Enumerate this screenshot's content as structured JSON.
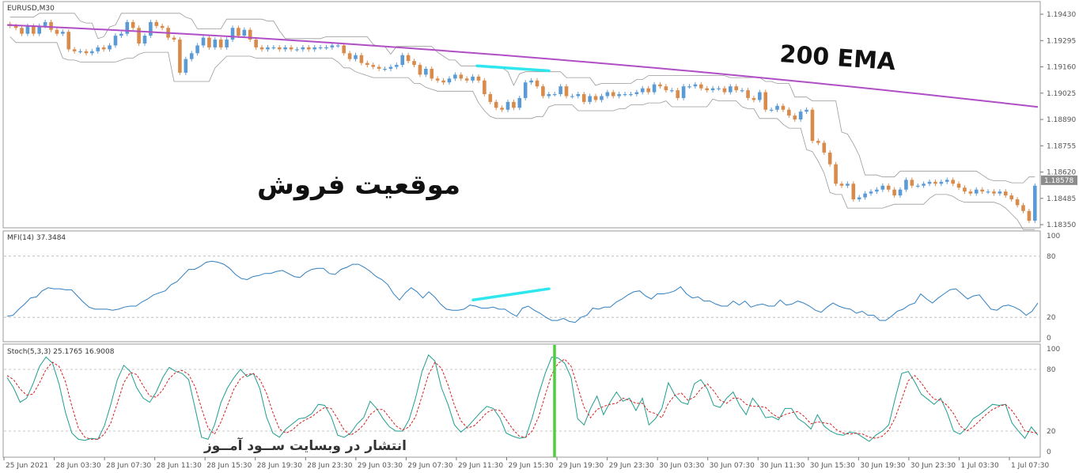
{
  "chart_header": {
    "symbol": "EURUSD,M30",
    "mfi_label": "MFI(14) 37.3484",
    "stoch_label": "Stoch(5,3,3) 25.1765 16.9008"
  },
  "annotations": {
    "position_text": "موقعیت فروش",
    "ema_text": "200 EMA",
    "footer_text": "انتشار در وبسایت ســود آمــوز"
  },
  "colors": {
    "bull": "#5b9bd5",
    "bear": "#d98b4b",
    "ema": "#b04fc5",
    "band": "#9a9a9a",
    "mfi": "#2f7fc1",
    "stoch_main": "#1f9e8f",
    "stoch_signal": "#d42020",
    "divergence": "#2ee6ee",
    "vline": "#4ccf3c"
  },
  "chart_data": [
    {
      "type": "candlestick",
      "title": "EURUSD,M30",
      "price_ticks": [
        "1.19430",
        "1.19295",
        "1.19160",
        "1.19025",
        "1.18890",
        "1.18755",
        "1.18620",
        "1.18485",
        "1.18350"
      ],
      "current_price": "1.18578",
      "ylim": [
        1.18342,
        1.19487
      ],
      "x_ticks": [
        "25 Jun 2021",
        "28 Jun 03:30",
        "28 Jun 07:30",
        "28 Jun 11:30",
        "28 Jun 15:30",
        "28 Jun 19:30",
        "28 Jun 23:30",
        "29 Jun 03:30",
        "29 Jun 07:30",
        "29 Jun 11:30",
        "29 Jun 15:30",
        "29 Jun 19:30",
        "29 Jun 23:30",
        "30 Jun 03:30",
        "30 Jun 07:30",
        "30 Jun 11:30",
        "30 Jun 15:30",
        "30 Jun 19:30",
        "30 Jun 23:30",
        "1 Jul 03:30",
        "1 Jul 07:30"
      ],
      "close": [
        1.1937,
        1.1936,
        1.1933,
        1.1937,
        1.1933,
        1.1937,
        1.1939,
        1.1935,
        1.1933,
        1.1934,
        1.1925,
        1.1924,
        1.1924,
        1.1923,
        1.1924,
        1.1926,
        1.1925,
        1.1927,
        1.1932,
        1.1933,
        1.1939,
        1.1936,
        1.1928,
        1.1932,
        1.1939,
        1.1937,
        1.1936,
        1.1931,
        1.193,
        1.1913,
        1.192,
        1.1923,
        1.1927,
        1.1931,
        1.1926,
        1.193,
        1.1926,
        1.193,
        1.1936,
        1.1932,
        1.1935,
        1.193,
        1.1926,
        1.1925,
        1.1926,
        1.1926,
        1.1925,
        1.1926,
        1.1925,
        1.1925,
        1.1926,
        1.1925,
        1.1926,
        1.1926,
        1.1926,
        1.1927,
        1.1927,
        1.1923,
        1.192,
        1.1922,
        1.1918,
        1.1917,
        1.1916,
        1.1915,
        1.1915,
        1.1916,
        1.1917,
        1.1922,
        1.1919,
        1.1917,
        1.1912,
        1.1915,
        1.191,
        1.1909,
        1.1908,
        1.191,
        1.1912,
        1.191,
        1.1909,
        1.1911,
        1.1909,
        1.1902,
        1.1898,
        1.1895,
        1.1894,
        1.1898,
        1.1895,
        1.19,
        1.1908,
        1.1909,
        1.1906,
        1.1901,
        1.1902,
        1.1902,
        1.1906,
        1.1901,
        1.1901,
        1.1902,
        1.1898,
        1.1901,
        1.1899,
        1.1901,
        1.1903,
        1.1901,
        1.1902,
        1.1902,
        1.1902,
        1.1903,
        1.1905,
        1.1903,
        1.1907,
        1.1906,
        1.1904,
        1.1904,
        1.19,
        1.1906,
        1.1906,
        1.1907,
        1.1905,
        1.1904,
        1.1905,
        1.1905,
        1.1903,
        1.1906,
        1.1904,
        1.1904,
        1.19,
        1.1899,
        1.1903,
        1.1894,
        1.1894,
        1.1896,
        1.1894,
        1.1891,
        1.1889,
        1.1893,
        1.1894,
        1.1878,
        1.1877,
        1.1872,
        1.1866,
        1.1856,
        1.1855,
        1.1856,
        1.1848,
        1.1849,
        1.1851,
        1.1852,
        1.1853,
        1.1855,
        1.1853,
        1.185,
        1.1853,
        1.1858,
        1.1855,
        1.1855,
        1.1856,
        1.1857,
        1.1856,
        1.1857,
        1.1858,
        1.1856,
        1.1854,
        1.1852,
        1.1851,
        1.1853,
        1.1852,
        1.1852,
        1.1851,
        1.1852,
        1.185,
        1.1848,
        1.1845,
        1.1842,
        1.1837,
        1.1855
      ],
      "ema200_endpoints": [
        1.19375,
        1.18954
      ],
      "bands": "upper/lower price envelope",
      "divergence_line": [
        "1.19165",
        "1.19140"
      ]
    },
    {
      "type": "line",
      "title": "MFI(14) 37.3484",
      "ylim": [
        0,
        100
      ],
      "y_ticks": [
        "100",
        "80",
        "20",
        "0"
      ],
      "levels": [
        80,
        20
      ],
      "values": [
        21,
        22,
        28,
        33,
        39,
        40,
        46,
        49,
        48,
        48,
        47,
        47,
        41,
        35,
        30,
        28,
        28,
        28,
        27,
        28,
        30,
        31,
        31,
        35,
        38,
        42,
        44,
        46,
        52,
        55,
        61,
        67,
        67,
        70,
        74,
        75,
        74,
        72,
        68,
        62,
        58,
        57,
        60,
        61,
        63,
        63,
        65,
        66,
        63,
        60,
        59,
        64,
        67,
        68,
        68,
        63,
        62,
        67,
        69,
        72,
        72,
        69,
        65,
        60,
        57,
        52,
        43,
        37,
        44,
        49,
        45,
        39,
        45,
        40,
        33,
        28,
        27,
        27,
        28,
        32,
        31,
        29,
        29,
        30,
        28,
        28,
        24,
        21,
        29,
        31,
        27,
        24,
        20,
        17,
        17,
        19,
        16,
        15,
        20,
        22,
        29,
        28,
        30,
        30,
        35,
        38,
        42,
        45,
        46,
        41,
        38,
        43,
        43,
        44,
        46,
        50,
        43,
        39,
        40,
        36,
        36,
        33,
        31,
        31,
        36,
        32,
        36,
        30,
        32,
        33,
        31,
        31,
        37,
        32,
        33,
        36,
        34,
        31,
        27,
        25,
        30,
        34,
        31,
        29,
        28,
        24,
        26,
        22,
        22,
        17,
        17,
        21,
        26,
        28,
        32,
        34,
        43,
        38,
        34,
        39,
        43,
        47,
        48,
        43,
        38,
        41,
        42,
        35,
        28,
        27,
        31,
        32,
        30,
        27,
        22,
        26,
        34
      ],
      "divergence_line": "rising"
    },
    {
      "type": "line",
      "title": "Stoch(5,3,3) 25.1765 16.9008",
      "ylim": [
        0,
        100
      ],
      "y_ticks": [
        "100",
        "80",
        "20",
        "0"
      ],
      "levels": [
        80,
        20
      ],
      "series": [
        {
          "name": "Stoch(5,3,3) 25.1765",
          "values": [
            72,
            62,
            48,
            52,
            66,
            83,
            92,
            86,
            66,
            38,
            18,
            12,
            11,
            13,
            12,
            25,
            46,
            70,
            84,
            78,
            62,
            52,
            48,
            58,
            72,
            82,
            78,
            76,
            70,
            42,
            14,
            12,
            26,
            48,
            62,
            72,
            80,
            73,
            76,
            61,
            34,
            18,
            14,
            22,
            27,
            32,
            33,
            37,
            46,
            45,
            34,
            16,
            14,
            18,
            27,
            33,
            49,
            42,
            32,
            24,
            20,
            20,
            31,
            52,
            78,
            94,
            88,
            62,
            46,
            26,
            19,
            24,
            31,
            38,
            44,
            42,
            33,
            18,
            15,
            13,
            14,
            33,
            56,
            76,
            92,
            91,
            86,
            72,
            32,
            26,
            42,
            54,
            36,
            48,
            58,
            49,
            52,
            40,
            52,
            26,
            32,
            42,
            67,
            55,
            48,
            46,
            66,
            70,
            61,
            45,
            43,
            52,
            58,
            45,
            36,
            52,
            44,
            33,
            34,
            31,
            42,
            42,
            32,
            28,
            22,
            36,
            25,
            20,
            17,
            16,
            19,
            18,
            14,
            10,
            16,
            20,
            26,
            52,
            76,
            78,
            68,
            56,
            51,
            46,
            52,
            38,
            20,
            17,
            23,
            32,
            36,
            41,
            46,
            45,
            46,
            28,
            20,
            13,
            24,
            16
          ],
          "color": "#1f9e8f"
        },
        {
          "name": "16.9008",
          "values": [
            74,
            70,
            61,
            55,
            56,
            67,
            80,
            87,
            83,
            68,
            44,
            23,
            14,
            12,
            12,
            17,
            28,
            47,
            67,
            77,
            75,
            64,
            54,
            53,
            60,
            71,
            77,
            79,
            75,
            63,
            42,
            23,
            17,
            29,
            45,
            61,
            71,
            75,
            76,
            70,
            57,
            38,
            22,
            18,
            21,
            27,
            31,
            34,
            39,
            43,
            42,
            32,
            21,
            16,
            20,
            26,
            36,
            41,
            41,
            33,
            25,
            21,
            24,
            34,
            54,
            75,
            87,
            81,
            65,
            45,
            30,
            23,
            25,
            31,
            38,
            41,
            40,
            31,
            22,
            15,
            14,
            20,
            34,
            55,
            75,
            86,
            90,
            83,
            63,
            43,
            33,
            41,
            44,
            46,
            47,
            52,
            50,
            47,
            47,
            39,
            37,
            33,
            47,
            55,
            57,
            50,
            53,
            61,
            66,
            59,
            50,
            47,
            52,
            52,
            46,
            44,
            44,
            43,
            37,
            33,
            36,
            38,
            39,
            34,
            27,
            29,
            28,
            27,
            21,
            18,
            17,
            18,
            17,
            14,
            13,
            15,
            21,
            33,
            51,
            69,
            74,
            67,
            58,
            51,
            50,
            45,
            37,
            25,
            20,
            24,
            30,
            36,
            41,
            44,
            46,
            40,
            31,
            20,
            19,
            18
          ],
          "color": "#d42020",
          "dashed": true
        }
      ],
      "marker": "vertical line at 29 Jun 15:30"
    }
  ]
}
